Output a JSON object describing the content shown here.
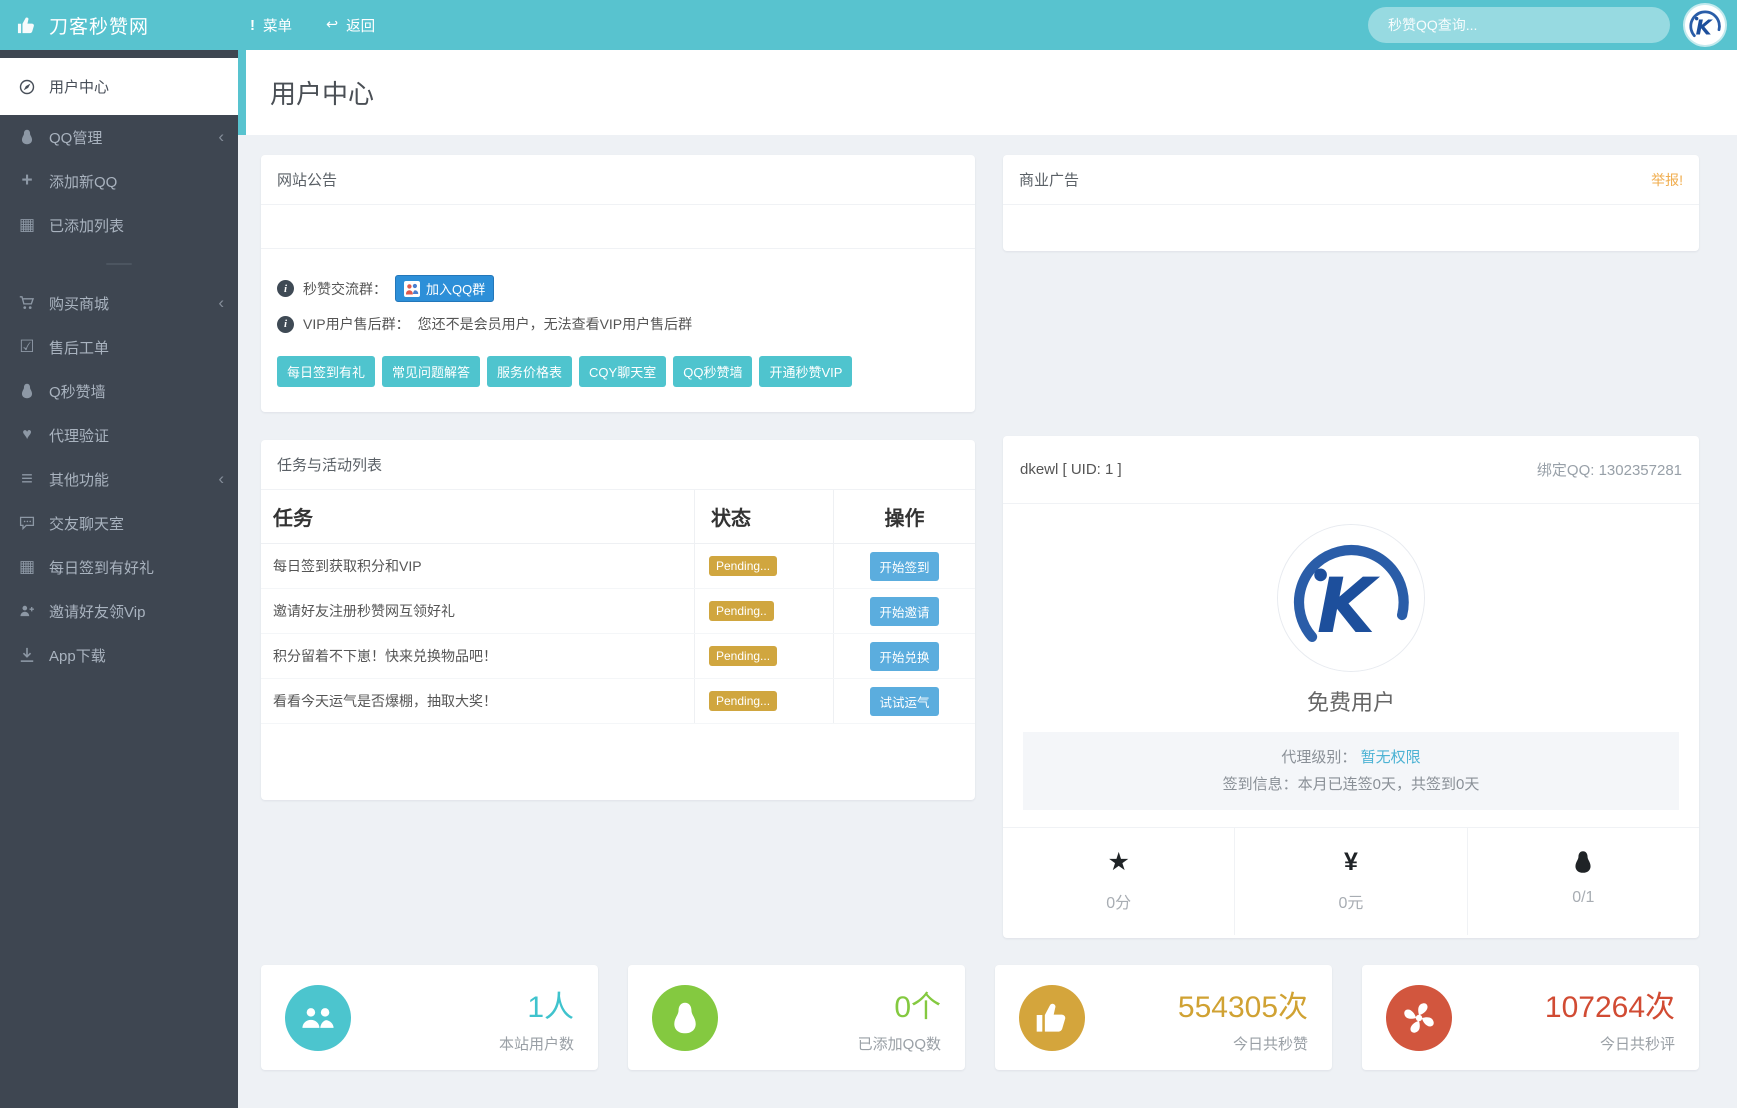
{
  "navbar": {
    "brand": "刀客秒赞网",
    "menu": "菜单",
    "back": "返回",
    "search_placeholder": "秒赞QQ查询..."
  },
  "icons": {
    "info": "i",
    "star": "★",
    "yuan": "¥",
    "plus": "+",
    "table": "▦",
    "check": "☑",
    "heart": "♥",
    "bars": "≡",
    "chevron_left": "‹",
    "menu_exclaim": "!",
    "back_arrow": "↩"
  },
  "sidebar": {
    "items": [
      {
        "label": "用户中心",
        "icon": "compass-icon",
        "active": true
      },
      {
        "label": "QQ管理",
        "icon": "penguin-icon",
        "collapsed": true
      },
      {
        "label": "添加新QQ",
        "icon": "plus-icon"
      },
      {
        "label": "已添加列表",
        "icon": "table-icon"
      },
      {
        "label": "购买商城",
        "icon": "cart-icon",
        "collapsed": true
      },
      {
        "label": "售后工单",
        "icon": "check-square-icon"
      },
      {
        "label": "Q秒赞墙",
        "icon": "penguin-icon"
      },
      {
        "label": "代理验证",
        "icon": "heart-icon"
      },
      {
        "label": "其他功能",
        "icon": "bars-icon",
        "collapsed": true
      },
      {
        "label": "交友聊天室",
        "icon": "chat-icon"
      },
      {
        "label": "每日签到有好礼",
        "icon": "table-icon"
      },
      {
        "label": "邀请好友领Vip",
        "icon": "user-plus-icon"
      },
      {
        "label": "App下载",
        "icon": "download-icon"
      }
    ]
  },
  "page_title": "用户中心",
  "announcement": {
    "title": "网站公告",
    "group_label": "秒赞交流群：",
    "join_button": "加入QQ群",
    "vip_label": "VIP用户售后群：",
    "vip_text": "您还不是会员用户，无法查看VIP用户售后群",
    "quick_buttons": [
      "每日签到有礼",
      "常见问题解答",
      "服务价格表",
      "CQY聊天室",
      "QQ秒赞墙",
      "开通秒赞VIP"
    ]
  },
  "ad_panel": {
    "title": "商业广告",
    "report": "举报!"
  },
  "tasks": {
    "title": "任务与活动列表",
    "columns": [
      "任务",
      "状态",
      "操作"
    ],
    "rows": [
      {
        "task": "每日签到获取积分和VIP",
        "status": "Pending...",
        "action": "开始签到"
      },
      {
        "task": "邀请好友注册秒赞网互领好礼",
        "status": "Pending..",
        "action": "开始邀请"
      },
      {
        "task": "积分留着不下崽！快来兑换物品吧！",
        "status": "Pending...",
        "action": "开始兑换"
      },
      {
        "task": "看看今天运气是否爆棚，抽取大奖！",
        "status": "Pending...",
        "action": "试试运气"
      }
    ]
  },
  "profile": {
    "username": "dkewl [ UID:  1 ]",
    "bind_qq": "绑定QQ:  1302357281",
    "role": "免费用户",
    "agent_label": "代理级别：",
    "agent_value": "暂无权限",
    "sign_info": "签到信息：本月已连签0天，共签到0天",
    "stats": [
      {
        "icon": "star-icon",
        "value": "0分"
      },
      {
        "icon": "yuan-icon",
        "value": "0元"
      },
      {
        "icon": "penguin-icon",
        "value": "0/1"
      }
    ]
  },
  "stat_cards": [
    {
      "icon": "users-icon",
      "value": "1人",
      "label": "本站用户数",
      "color": "#4cc5ce"
    },
    {
      "icon": "penguin-icon",
      "value": "0个",
      "label": "已添加QQ数",
      "color": "#84c940"
    },
    {
      "icon": "thumbs-up-icon",
      "value": "554305次",
      "label": "今日共秒赞",
      "color": "#d4a53c"
    },
    {
      "icon": "fan-icon",
      "value": "107264次",
      "label": "今日共秒评",
      "color": "#d2563e"
    }
  ],
  "colors": {
    "navbar_teal": "#58c3cf",
    "sidebar_dark": "#3e4651",
    "quick_button_teal": "#4fc4ce",
    "join_button_blue": "#2d8fd8",
    "badge_yellow": "#d0a63f",
    "action_blue": "#5badde",
    "report_orange": "#f0ad4e",
    "link_teal": "#4db3d4"
  }
}
